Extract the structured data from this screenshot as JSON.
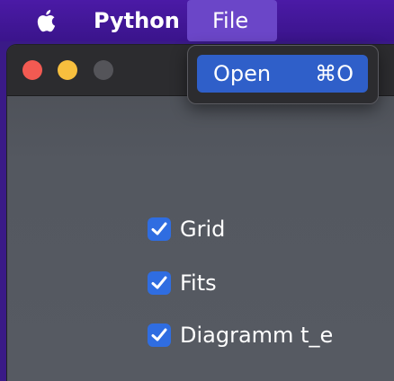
{
  "menubar": {
    "app_name": "Python",
    "menus": [
      {
        "label": "File"
      }
    ]
  },
  "file_menu": {
    "items": [
      {
        "label": "Open",
        "shortcut": "⌘O"
      }
    ]
  },
  "window": {
    "checkboxes": [
      {
        "label": "Grid",
        "checked": true
      },
      {
        "label": "Fits",
        "checked": true
      },
      {
        "label": "Diagramm t_e",
        "checked": true
      }
    ]
  },
  "colors": {
    "menubar": "#4b1aa6",
    "menu_highlight": "#6b46c8",
    "selection": "#2f5fc9",
    "checkbox": "#2f6de1",
    "close": "#f25a52",
    "minimize": "#f7bf3e",
    "zoom_disabled": "#545459"
  }
}
